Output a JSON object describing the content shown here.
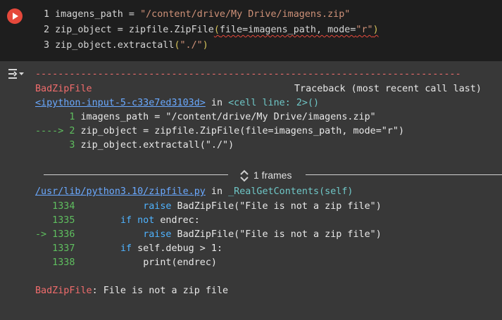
{
  "cell": {
    "lines": [
      {
        "num": "1",
        "var": "imagens_path",
        "op": " = ",
        "str": "\"/content/drive/My Drive/imagens.zip\""
      },
      {
        "num": "2",
        "a": "zip_object = zipfile.ZipFile",
        "open": "(",
        "args1": "file=imagens_path, mode=",
        "str": "\"r\"",
        "close": ")"
      },
      {
        "num": "3",
        "a": "zip_object.extractall",
        "open": "(",
        "str": "\"./\"",
        "close": ")"
      }
    ]
  },
  "output": {
    "dashes": "---------------------------------------------------------------------------",
    "error_name": "BadZipFile",
    "traceback_label": "Traceback (most recent call last)",
    "link1": "<ipython-input-5-c33e7ed3103d>",
    "in_text": " in ",
    "cell_line": "<cell line: 2>()",
    "tb": [
      {
        "prefix": "      1 ",
        "text": "imagens_path = \"/content/drive/My Drive/imagens.zip\""
      },
      {
        "prefix": "----> 2 ",
        "text": "zip_object = zipfile.ZipFile(file=imagens_path, mode=\"r\")"
      },
      {
        "prefix": "      3 ",
        "text": "zip_object.extractall(\"./\")"
      }
    ],
    "frames_label": "1 frames",
    "link2": "/usr/lib/python3.10/zipfile.py",
    "func": "_RealGetContents(self)",
    "src": [
      {
        "prefix": "   1334 ",
        "indent": "           ",
        "kw": "raise",
        "rest": " BadZipFile(\"File is not a zip file\")"
      },
      {
        "prefix": "   1335 ",
        "indent": "       ",
        "kw": "if not",
        "rest": " endrec:"
      },
      {
        "prefix": "-> 1336 ",
        "indent": "           ",
        "kw": "raise",
        "rest": " BadZipFile(\"File is not a zip file\")"
      },
      {
        "prefix": "   1337 ",
        "indent": "       ",
        "kw": "if",
        "rest": " self.debug > 1:"
      },
      {
        "prefix": "   1338 ",
        "indent": "           ",
        "kw": "",
        "rest": "print(endrec)"
      }
    ],
    "final_error": "BadZipFile",
    "final_msg": ": File is not a zip file"
  }
}
